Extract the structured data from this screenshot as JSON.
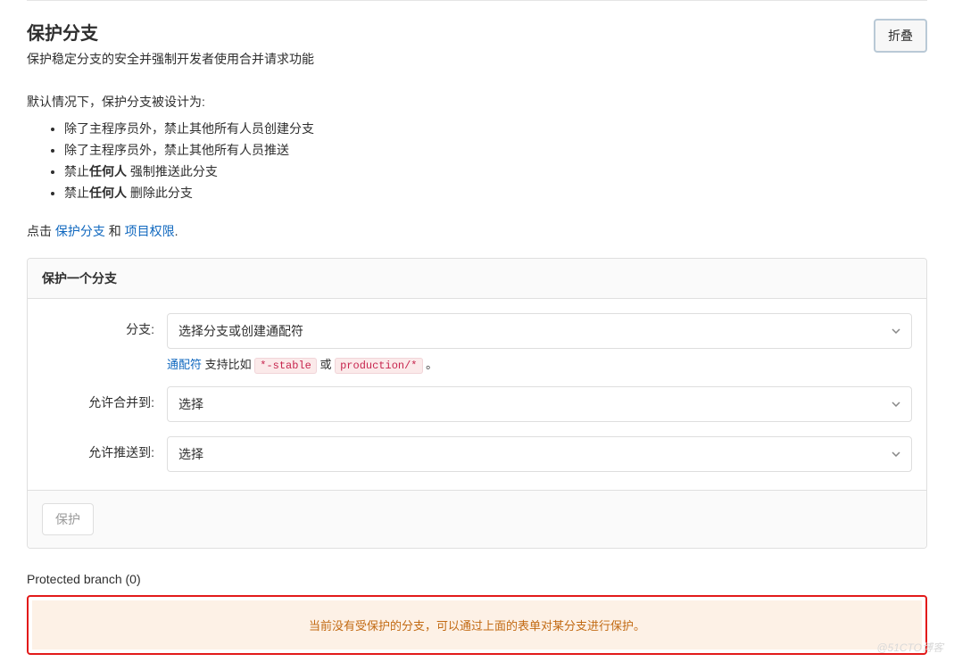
{
  "header": {
    "title": "保护分支",
    "subtitle": "保护稳定分支的安全并强制开发者使用合并请求功能",
    "collapse_label": "折叠"
  },
  "description": {
    "intro": "默认情况下，保护分支被设计为:",
    "rules": [
      {
        "prefix": "除了主程序员外，禁止其他所有人员创建分支",
        "bold": ""
      },
      {
        "prefix": "除了主程序员外，禁止其他所有人员推送",
        "bold": ""
      },
      {
        "prefix": "禁止",
        "bold": "任何人",
        "suffix": " 强制推送此分支"
      },
      {
        "prefix": "禁止",
        "bold": "任何人",
        "suffix": " 删除此分支"
      }
    ],
    "links_line": {
      "prefix": "点击 ",
      "link1": "保护分支",
      "mid": " 和 ",
      "link2": "项目权限",
      "tail": "."
    }
  },
  "panel": {
    "heading": "保护一个分支",
    "branch": {
      "label": "分支:",
      "placeholder": "选择分支或创建通配符",
      "help": {
        "wildcard_link": "通配符",
        "text_mid": " 支持比如 ",
        "code1": "*-stable",
        "or": " 或 ",
        "code2": "production/*",
        "tail": " 。"
      }
    },
    "merge": {
      "label": "允许合并到:",
      "placeholder": "选择"
    },
    "push": {
      "label": "允许推送到:",
      "placeholder": "选择"
    },
    "protect_button": "保护"
  },
  "protected_section": {
    "heading_prefix": "Protected branch (",
    "count": "0",
    "heading_suffix": ")",
    "empty_message": "当前没有受保护的分支，可以通过上面的表单对某分支进行保护。"
  },
  "watermark": "@51CTO博客"
}
